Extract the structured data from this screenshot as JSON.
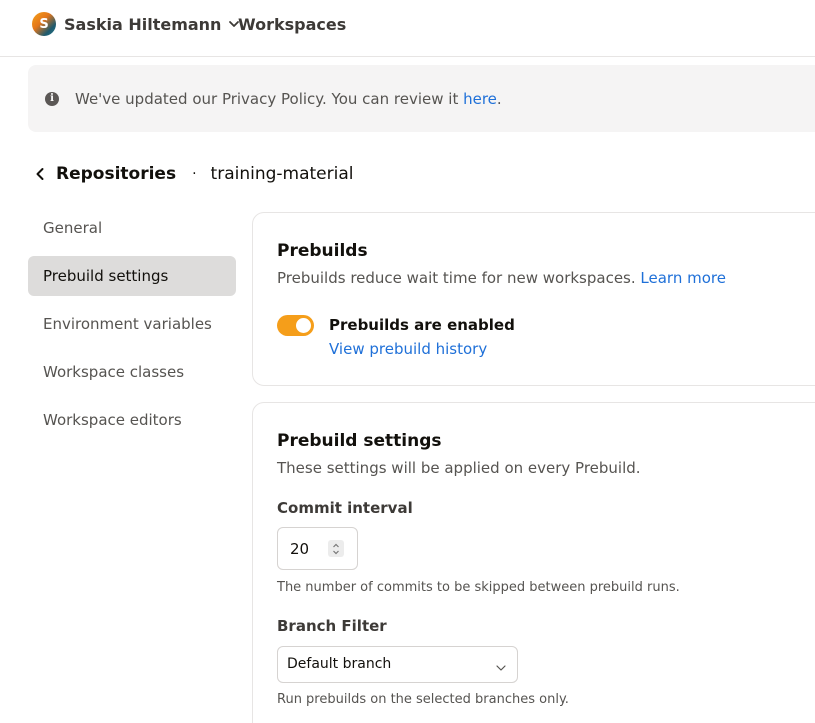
{
  "header": {
    "avatar_initial": "S",
    "user_name": "Saskia Hiltemann",
    "nav_workspaces": "Workspaces"
  },
  "banner": {
    "text": "We've updated our Privacy Policy. You can review it ",
    "link": "here",
    "suffix": ".",
    "icon": "info-icon"
  },
  "breadcrumb": {
    "back_label": "Repositories",
    "separator": "·",
    "repo_name": "training-material"
  },
  "sidebar": {
    "items": [
      {
        "label": "General",
        "active": false
      },
      {
        "label": "Prebuild settings",
        "active": true
      },
      {
        "label": "Environment variables",
        "active": false
      },
      {
        "label": "Workspace classes",
        "active": false
      },
      {
        "label": "Workspace editors",
        "active": false
      }
    ]
  },
  "prebuilds_card": {
    "title": "Prebuilds",
    "description": "Prebuilds reduce wait time for new workspaces. ",
    "learn_more": "Learn more",
    "toggle_label": "Prebuilds are enabled",
    "toggle_on": true,
    "history_link": "View prebuild history"
  },
  "settings_card": {
    "title": "Prebuild settings",
    "description": "These settings will be applied on every Prebuild.",
    "commit_interval_label": "Commit interval",
    "commit_interval_value": "20",
    "commit_interval_hint": "The number of commits to be skipped between prebuild runs.",
    "branch_filter_label": "Branch Filter",
    "branch_filter_value": "Default branch",
    "branch_filter_hint": "Run prebuilds on the selected branches only."
  },
  "colors": {
    "accent_orange": "#f59e1a",
    "link_blue": "#1f70d8",
    "active_bg": "#dddcdb"
  }
}
